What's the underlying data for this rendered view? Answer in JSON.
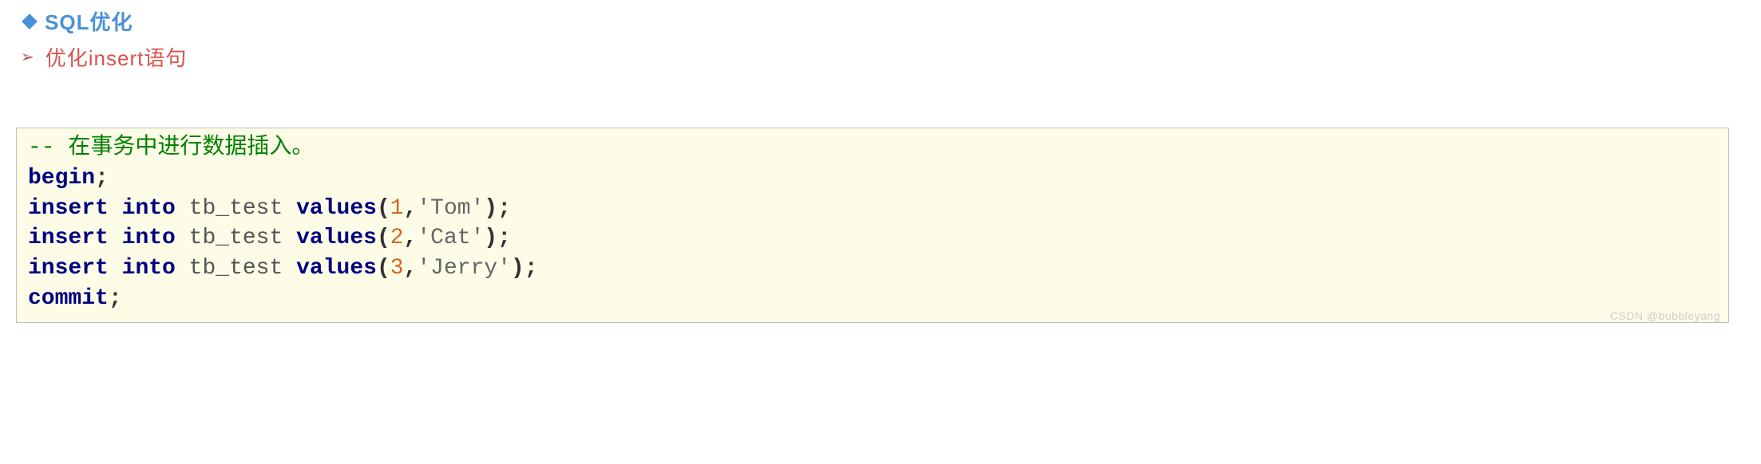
{
  "header": {
    "title": "SQL优化",
    "subtitle": "优化insert语句"
  },
  "code": {
    "comment_prefix": "-- ",
    "comment_text": "在事务中进行数据插入。",
    "lines": [
      {
        "kw1": "begin",
        "semi": ";"
      },
      {
        "kw1": "insert",
        "kw2": "into",
        "table": "tb_test",
        "kw3": "values",
        "lparen": "(",
        "num": "1",
        "comma": ",",
        "str": "'Tom'",
        "rparen": ")",
        "semi": ";"
      },
      {
        "kw1": "insert",
        "kw2": "into",
        "table": "tb_test",
        "kw3": "values",
        "lparen": "(",
        "num": "2",
        "comma": ",",
        "str": "'Cat'",
        "rparen": ")",
        "semi": ";"
      },
      {
        "kw1": "insert",
        "kw2": "into",
        "table": "tb_test",
        "kw3": "values",
        "lparen": "(",
        "num": "3",
        "comma": ",",
        "str": "'Jerry'",
        "rparen": ")",
        "semi": ";"
      },
      {
        "kw1": "commit",
        "semi": ";"
      }
    ]
  },
  "watermark": "CSDN @bubbleyang"
}
